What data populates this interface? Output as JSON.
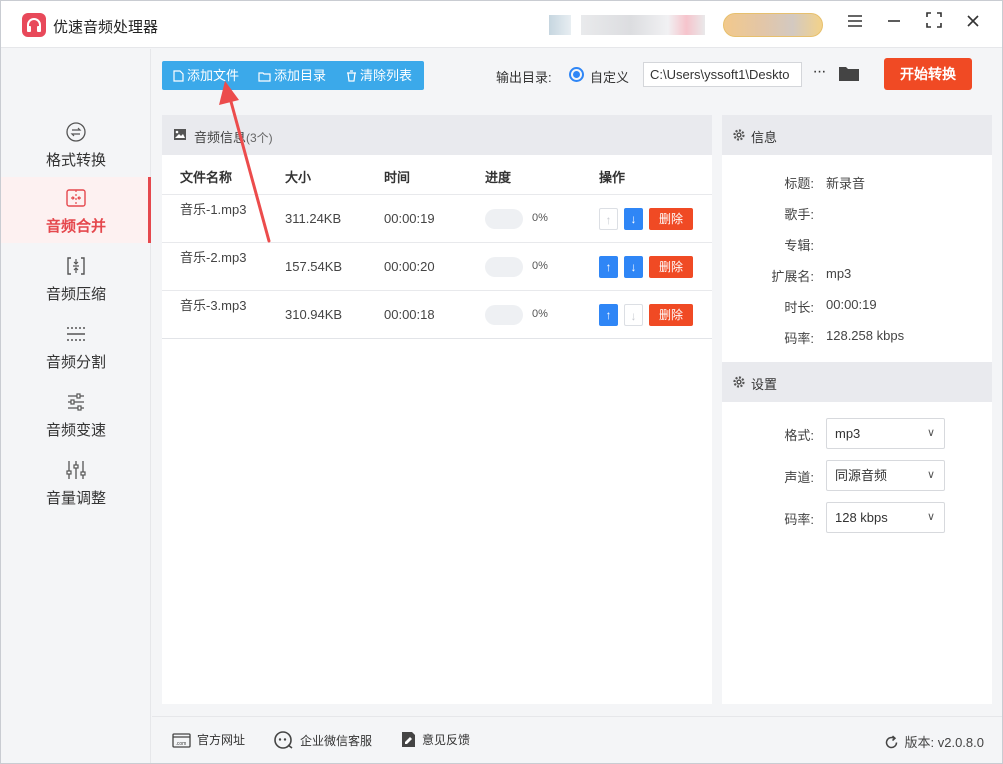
{
  "app": {
    "title": "优速音频处理器"
  },
  "sidebar": {
    "items": [
      {
        "label": "格式转换",
        "icon": "format-convert-icon",
        "active": false
      },
      {
        "label": "音频合并",
        "icon": "audio-merge-icon",
        "active": true
      },
      {
        "label": "音频压缩",
        "icon": "audio-compress-icon",
        "active": false
      },
      {
        "label": "音频分割",
        "icon": "audio-split-icon",
        "active": false
      },
      {
        "label": "音频变速",
        "icon": "audio-speed-icon",
        "active": false
      },
      {
        "label": "音量调整",
        "icon": "volume-adjust-icon",
        "active": false
      }
    ]
  },
  "toolbar": {
    "add_file": "添加文件",
    "add_folder": "添加目录",
    "clear_list": "清除列表",
    "output_label": "输出目录:",
    "custom_option": "自定义",
    "output_path": "C:\\Users\\yssoft1\\Deskto",
    "more": "···",
    "start": "开始转换"
  },
  "file_panel": {
    "title": "音频信息",
    "count": "(3个)",
    "columns": {
      "name": "文件名称",
      "size": "大小",
      "time": "时间",
      "progress": "进度",
      "actions": "操作"
    },
    "rows": [
      {
        "name": "音乐-1.mp3",
        "size": "311.24KB",
        "time": "00:00:19",
        "progress": "0%",
        "up_enabled": false,
        "down_enabled": true,
        "delete": "删除"
      },
      {
        "name": "音乐-2.mp3",
        "size": "157.54KB",
        "time": "00:00:20",
        "progress": "0%",
        "up_enabled": true,
        "down_enabled": true,
        "delete": "删除"
      },
      {
        "name": "音乐-3.mp3",
        "size": "310.94KB",
        "time": "00:00:18",
        "progress": "0%",
        "up_enabled": true,
        "down_enabled": false,
        "delete": "删除"
      }
    ]
  },
  "info": {
    "title": "信息",
    "fields": [
      {
        "key": "标题:",
        "value": "新录音"
      },
      {
        "key": "歌手:",
        "value": ""
      },
      {
        "key": "专辑:",
        "value": ""
      },
      {
        "key": "扩展名:",
        "value": "mp3"
      },
      {
        "key": "时长:",
        "value": "00:00:19"
      },
      {
        "key": "码率:",
        "value": "128.258 kbps"
      }
    ]
  },
  "settings": {
    "title": "设置",
    "format_label": "格式:",
    "format_value": "mp3",
    "channel_label": "声道:",
    "channel_value": "同源音频",
    "bitrate_label": "码率:",
    "bitrate_value": "128 kbps"
  },
  "footer": {
    "website": "官方网址",
    "wechat": "企业微信客服",
    "feedback": "意见反馈",
    "version": "版本: v2.0.8.0"
  },
  "colors": {
    "accent_red": "#e5484d",
    "toolbar_blue": "#3ba9ea",
    "button_blue": "#2f86f6",
    "start_orange": "#f04a24"
  }
}
